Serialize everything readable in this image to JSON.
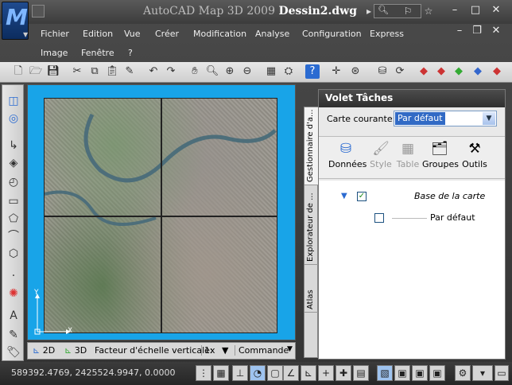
{
  "window": {
    "title_app": "AutoCAD Map 3D 2009",
    "title_doc": "Dessin2.dwg"
  },
  "menus": [
    "Fichier",
    "Edition",
    "Vue",
    "Créer",
    "Modification",
    "Analyse",
    "Configuration",
    "Express",
    "Image",
    "Fenêtre",
    "?"
  ],
  "canvas": {
    "tab_2d": "2D",
    "tab_3d": "3D",
    "scale_label": "Facteur d'échelle verticale:",
    "scale_value": "1x",
    "command_label": "Commande",
    "axis_y": "Y",
    "axis_x": "X"
  },
  "task_pane": {
    "title": "Volet Tâches",
    "vtabs": [
      "Gestionnaire d'a...",
      "Explorateur de ...",
      "Atlas"
    ],
    "current_map_label": "Carte courante:",
    "current_map_value": "Par défaut",
    "tools": [
      {
        "label": "Données",
        "icon": "database-icon",
        "enabled": true
      },
      {
        "label": "Style",
        "icon": "brush-icon",
        "enabled": false
      },
      {
        "label": "Table",
        "icon": "table-icon",
        "enabled": false
      },
      {
        "label": "Groupes",
        "icon": "folders-icon",
        "enabled": true
      },
      {
        "label": "Outils",
        "icon": "tools-icon",
        "enabled": true
      }
    ],
    "tree": {
      "root": "Base de la carte",
      "child": "Par défaut",
      "root_checked": true,
      "child_checked": false
    }
  },
  "status": {
    "coordinates": "589392.4769, 2425524.9947, 0.0000"
  }
}
